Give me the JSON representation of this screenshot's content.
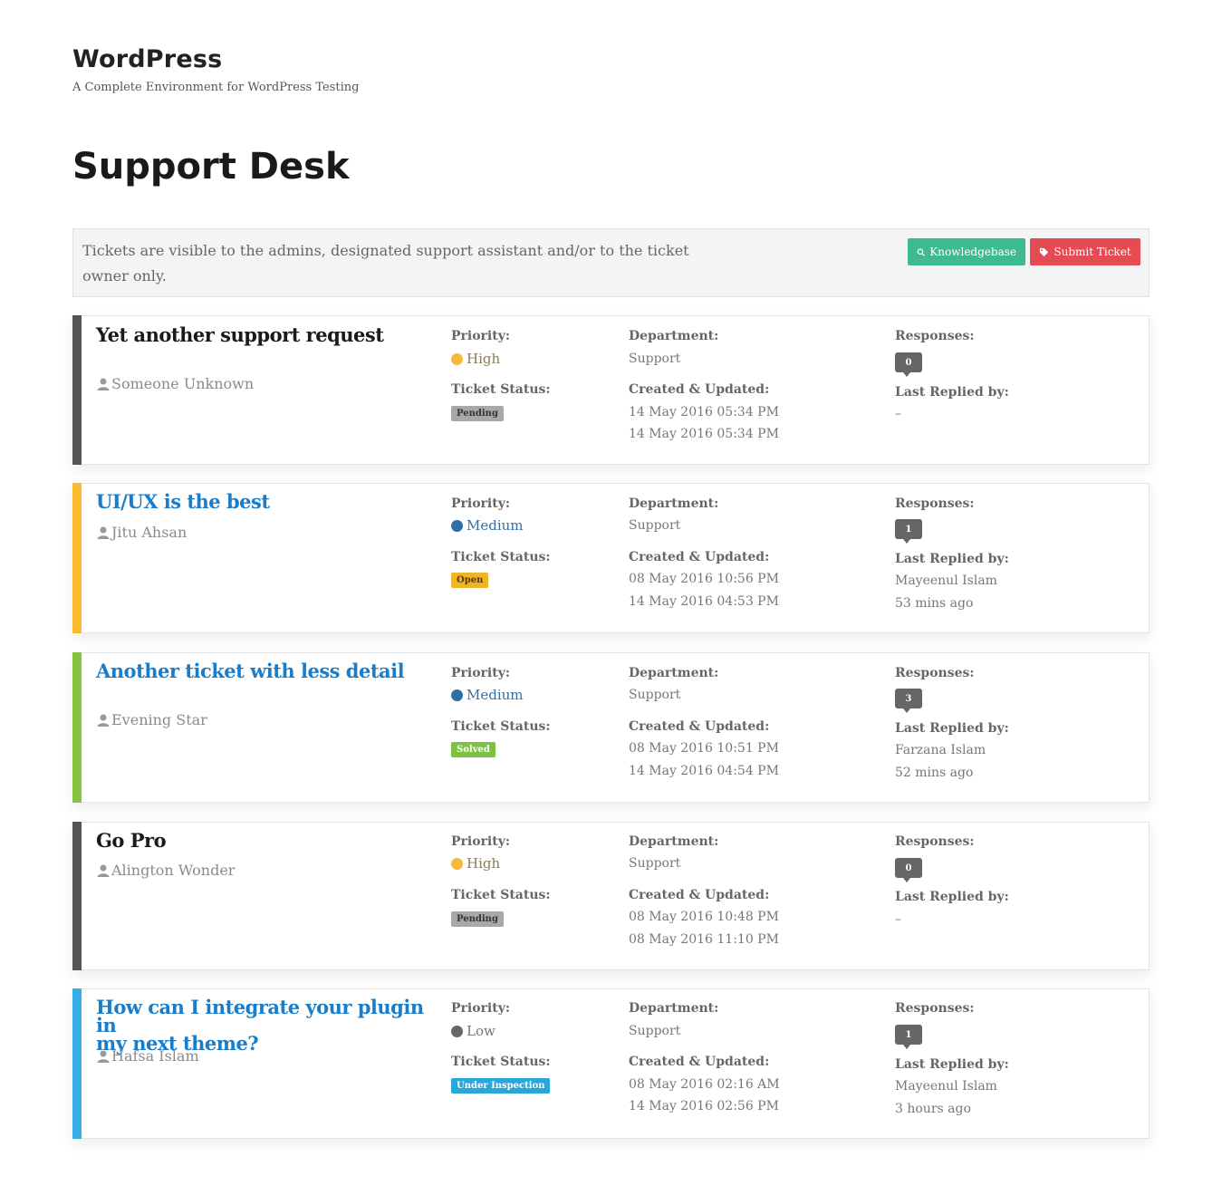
{
  "site": {
    "title": "WordPress",
    "tagline": "A Complete Environment for WordPress Testing"
  },
  "page_title": "Support Desk",
  "notice": {
    "text": "Tickets are visible to the admins, designated support assistant and/or to the ticket owner only.",
    "knowledgebase_label": "Knowledgebase",
    "submit_label": "Submit Ticket"
  },
  "labels": {
    "priority": "Priority:",
    "ticket_status": "Ticket Status:",
    "department": "Department:",
    "created_updated": "Created & Updated:",
    "responses": "Responses:",
    "last_replied": "Last Replied by:"
  },
  "colors": {
    "high": "#f6b93b",
    "medium": "#2e6fa8",
    "low": "#666666",
    "pending": "#a8a8a8",
    "open": "#f0b429",
    "solved": "#7cc142",
    "inspection": "#2aa7d9",
    "bar_dark": "#555555",
    "bar_yellow": "#f9bb2d",
    "bar_green": "#86c342",
    "bar_blue": "#34aee3"
  },
  "tickets": [
    {
      "title": "Yet another support request",
      "author": "Someone Unknown",
      "priority": "High",
      "status": "Pending",
      "department": "Support",
      "created": "14 May 2016 05:34 PM",
      "updated": "14 May 2016 05:34 PM",
      "responses": "0",
      "last_replied_by": "–",
      "last_replied_ago": ""
    },
    {
      "title": "UI/UX is the best",
      "author": "Jitu Ahsan",
      "priority": "Medium",
      "status": "Open",
      "department": "Support",
      "created": "08 May 2016 10:56 PM",
      "updated": "14 May 2016 04:53 PM",
      "responses": "1",
      "last_replied_by": "Mayeenul Islam",
      "last_replied_ago": "53 mins ago"
    },
    {
      "title": "Another ticket with less detail",
      "author": "Evening Star",
      "priority": "Medium",
      "status": "Solved",
      "department": "Support",
      "created": "08 May 2016 10:51 PM",
      "updated": "14 May 2016 04:54 PM",
      "responses": "3",
      "last_replied_by": "Farzana Islam",
      "last_replied_ago": "52 mins ago"
    },
    {
      "title": "Go Pro",
      "author": "Alington Wonder",
      "priority": "High",
      "status": "Pending",
      "department": "Support",
      "created": "08 May 2016 10:48 PM",
      "updated": "08 May 2016 11:10 PM",
      "responses": "0",
      "last_replied_by": "–",
      "last_replied_ago": ""
    },
    {
      "title_line1": "How can I integrate your plugin in",
      "title_line2": "my next theme?",
      "author": "Hafsa Islam",
      "priority": "Low",
      "status": "Under Inspection",
      "department": "Support",
      "created": "08 May 2016 02:16 AM",
      "updated": "14 May 2016 02:56 PM",
      "responses": "1",
      "last_replied_by": "Mayeenul Islam",
      "last_replied_ago": "3 hours ago"
    }
  ]
}
